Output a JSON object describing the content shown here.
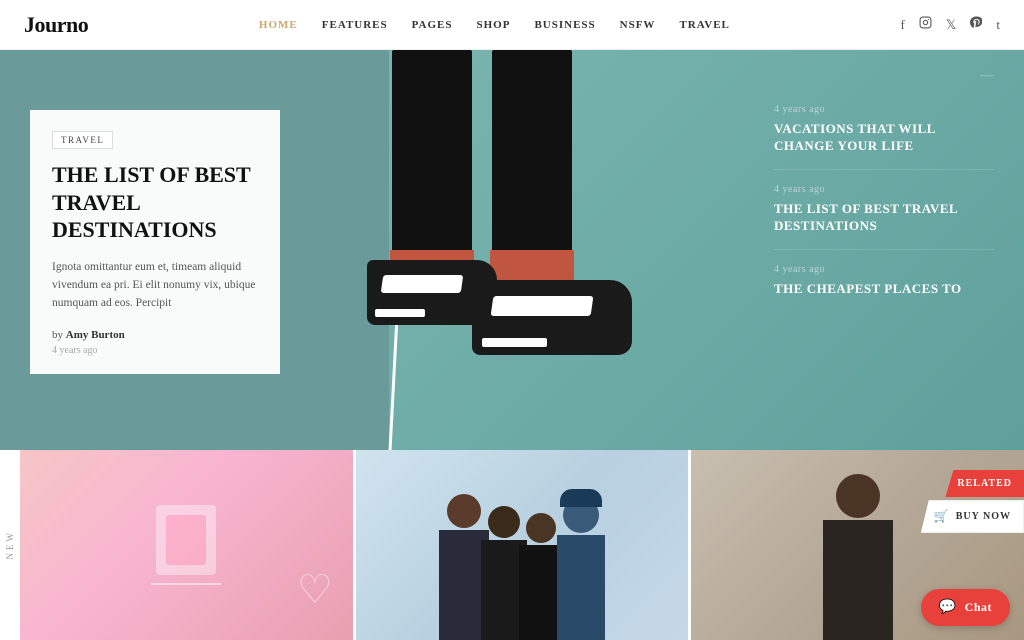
{
  "brand": {
    "logo": "Journo"
  },
  "nav": {
    "items": [
      {
        "label": "HOME",
        "active": true
      },
      {
        "label": "FEATURES",
        "active": false
      },
      {
        "label": "PAGES",
        "active": false
      },
      {
        "label": "SHOP",
        "active": false
      },
      {
        "label": "BUSINESS",
        "active": false
      },
      {
        "label": "NSFW",
        "active": false
      },
      {
        "label": "TRAVEL",
        "active": false
      }
    ]
  },
  "social": {
    "icons": [
      "f",
      "ig",
      "t",
      "p",
      "t2"
    ]
  },
  "hero": {
    "category": "TRAVEL",
    "title": "THE LIST OF BEST TRAVEL DESTINATIONS",
    "excerpt": "Ignota omittantur eum et, timeam aliquid vivendum ea pri. Ei elit nonumy vix, ubique numquam ad eos. Percipit",
    "author": "Amy Burton",
    "time": "4 years ago",
    "nav_line": "—"
  },
  "sidebar_articles": [
    {
      "time": "4 years ago",
      "title": "VACATIONS THAT WILL CHANGE YOUR LIFE"
    },
    {
      "time": "4 years ago",
      "title": "THE LIST OF BEST TRAVEL DESTINATIONS"
    },
    {
      "time": "4 years ago",
      "title": "THE CHEAPEST PLACES TO"
    }
  ],
  "bottom": {
    "section_label": "NEW",
    "cards": [
      {
        "id": "card-1",
        "type": "product"
      },
      {
        "id": "card-2",
        "type": "people"
      },
      {
        "id": "card-3",
        "type": "person"
      }
    ]
  },
  "floating": {
    "related_label": "RELATED",
    "buy_label": "BUY NOW",
    "chat_label": "Chat"
  },
  "colors": {
    "accent": "#e8403a",
    "nav_active": "#c8a96e",
    "hero_red": "#c0393a",
    "hero_teal": "#7ab5b0"
  }
}
